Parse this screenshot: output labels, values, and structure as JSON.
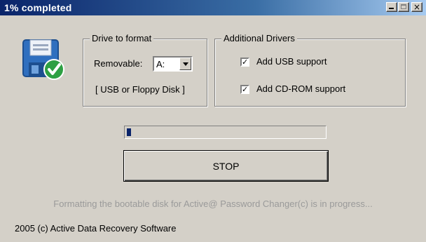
{
  "window": {
    "title": "1% completed",
    "min_label": "_",
    "max_label": "□",
    "close_label": "×"
  },
  "icon": {
    "name": "floppy-disk-checkmark-icon"
  },
  "drive_group": {
    "title": "Drive to format",
    "removable_label": "Removable:",
    "drive_value": "A:",
    "hint": "[ USB or Floppy Disk ]"
  },
  "drivers_group": {
    "title": "Additional Drivers",
    "usb_label": "Add USB support",
    "usb_checked": true,
    "cdrom_label": "Add CD-ROM support",
    "cdrom_checked": true,
    "check_mark": "✓"
  },
  "progress": {
    "percent": 1
  },
  "stop_button": {
    "label": "STOP"
  },
  "status_text": "Formatting the bootable disk for Active@ Password Changer(c) is in progress...",
  "footer_text": "2005 (c) Active Data Recovery Software",
  "colors": {
    "title_start": "#0a246a",
    "title_end": "#a6caf0",
    "face": "#d4d0c8",
    "progress_fill": "#0a246a"
  }
}
